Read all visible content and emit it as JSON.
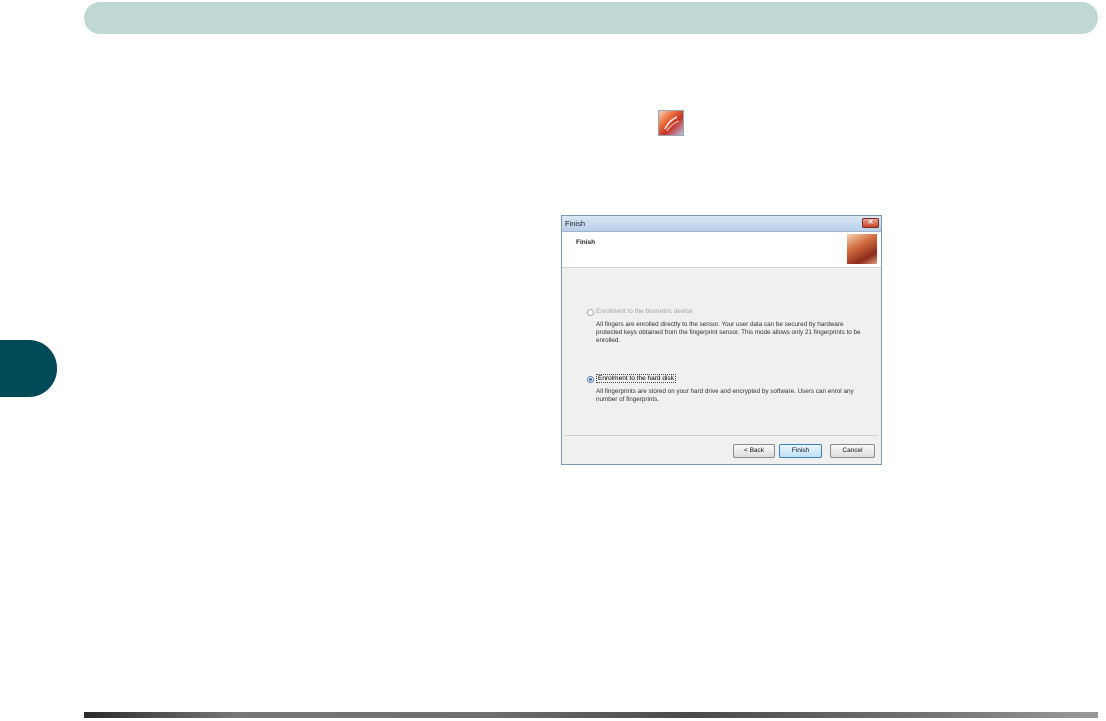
{
  "dialog": {
    "window_title": "Finish",
    "header_title": "Finish",
    "option1_label": "Enrolment to the biometric device",
    "option1_desc": "All fingers are enrolled directly to the sensor. Your user data can be secured by hardware protected keys obtained from the fingerprint sensor. This mode allows only 21 fingerprints to be enrolled.",
    "option2_label": "Enrolment to the hard disk",
    "option2_desc": "All fingerprints are stored on your hard drive and encrypted by software. Users can enrol any number of fingerprints.",
    "back_label": "< Back",
    "finish_label": "Finish",
    "cancel_label": "Cancel",
    "close_glyph": "✕",
    "selected_option": "Enrolment to the hard disk"
  },
  "colors": {
    "top_bar": "#bfd8d3",
    "side_tab": "#004a57"
  },
  "icons": {
    "float_icon": "fingerprint-app-icon",
    "header_icon": "fingerprint-image"
  }
}
